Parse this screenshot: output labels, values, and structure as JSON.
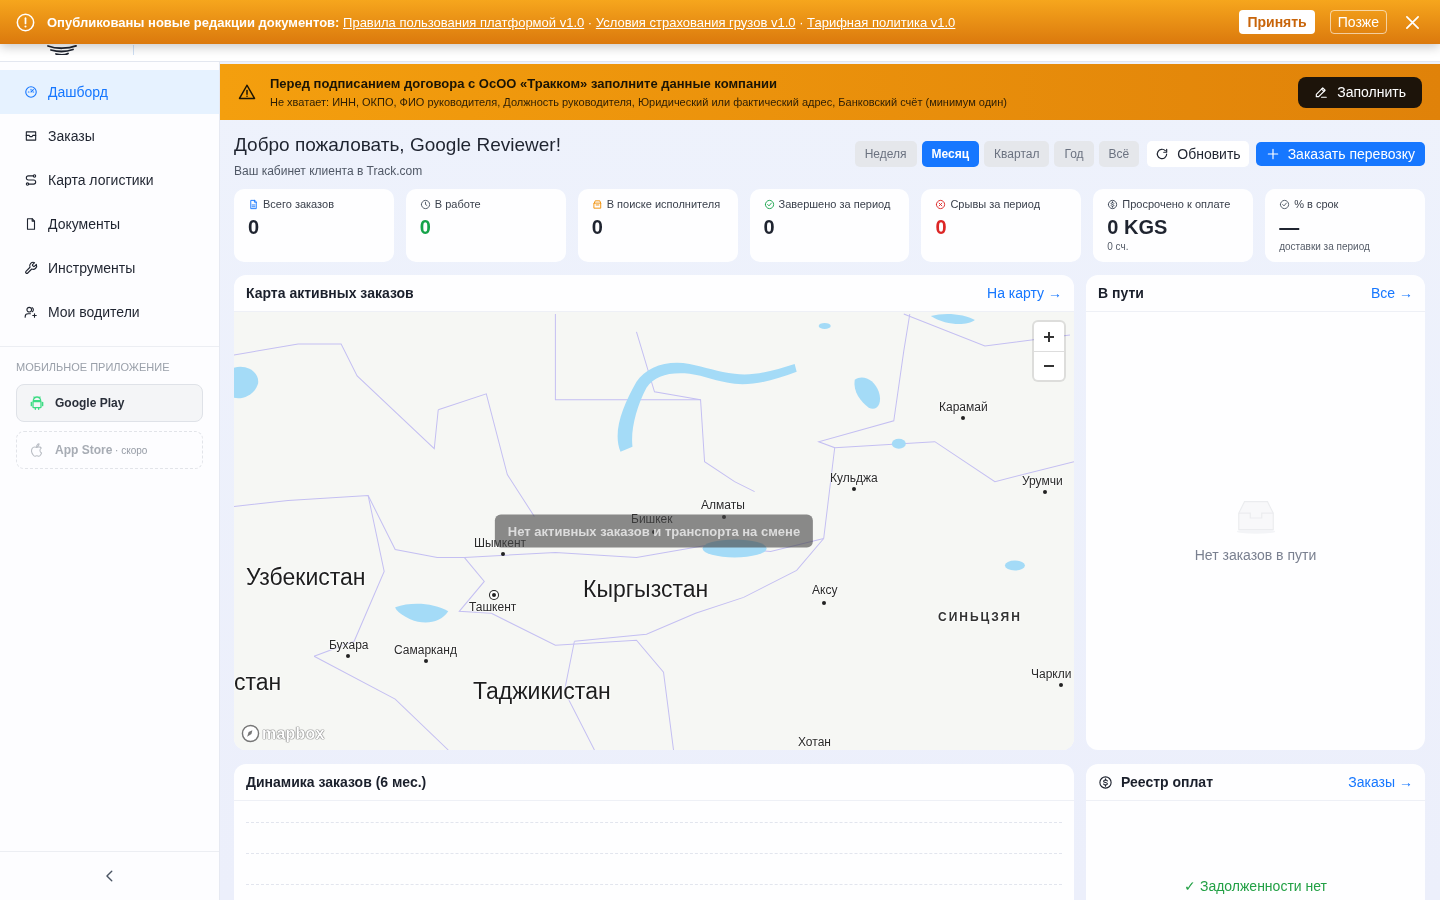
{
  "notice_banner": {
    "lead": "Опубликованы новые редакции документов:",
    "links": [
      "Правила пользования платформой v1.0",
      "Условия страхования грузов v1.0",
      "Тарифная политика v1.0"
    ],
    "separator": "·",
    "accept_button": "Принять",
    "later_button": "Позже"
  },
  "sidebar": {
    "items": [
      {
        "label": "Дашборд",
        "selected": true
      },
      {
        "label": "Заказы",
        "selected": false
      },
      {
        "label": "Карта логистики",
        "selected": false
      },
      {
        "label": "Документы",
        "selected": false
      },
      {
        "label": "Инструменты",
        "selected": false
      },
      {
        "label": "Мои водители",
        "selected": false
      }
    ],
    "mobile_app": {
      "heading": "МОБИЛЬНОЕ ПРИЛОЖЕНИЕ",
      "stores": [
        {
          "label": "Google Play",
          "disabled": false
        },
        {
          "label": "App Store",
          "note": "· скоро",
          "disabled": true
        }
      ]
    }
  },
  "company_alert": {
    "title": "Перед подписанием договора с ОсОО «Тракком» заполните данные компании",
    "missing": "Не хватает: ИНН, ОКПО, ФИО руководителя, Должность руководителя, Юридический или фактический адрес, Банковский счёт (минимум один)",
    "button": "Заполнить"
  },
  "welcome": {
    "title": "Добро пожаловать, Google Reviewer!",
    "subtitle": "Ваш кабинет клиента в Track.com"
  },
  "periods": [
    {
      "label": "Неделя",
      "selected": false
    },
    {
      "label": "Месяц",
      "selected": true
    },
    {
      "label": "Квартал",
      "selected": false
    },
    {
      "label": "Год",
      "selected": false
    },
    {
      "label": "Всё",
      "selected": false
    }
  ],
  "refresh_button": "Обновить",
  "order_button": "Заказать перевозку",
  "stats": [
    {
      "label": "Всего заказов",
      "value": "0",
      "color": "#1f2430"
    },
    {
      "label": "В работе",
      "value": "0",
      "color": "#16a34a"
    },
    {
      "label": "В поиске исполнителя",
      "value": "0",
      "color": "#1f2430"
    },
    {
      "label": "Завершено за период",
      "value": "0",
      "color": "#1f2430"
    },
    {
      "label": "Срывы за период",
      "value": "0",
      "color": "#dc2626"
    },
    {
      "label": "Просрочено к оплате",
      "value": "0 KGS",
      "note": "0 сч.",
      "color": "#1f2430"
    },
    {
      "label": "% в срок",
      "value": "—",
      "note": "доставки за период",
      "color": "#1f2430"
    }
  ],
  "map_card": {
    "title": "Карта активных заказов",
    "link": "На карту →",
    "labels": [
      {
        "text": "Карамай",
        "kind": "city"
      },
      {
        "text": "Кульджа",
        "kind": "city"
      },
      {
        "text": "Урумчи",
        "kind": "city"
      },
      {
        "text": "Алматы",
        "kind": "city"
      },
      {
        "text": "Бишкек",
        "kind": "city"
      },
      {
        "text": "Шымкент",
        "kind": "city"
      },
      {
        "text": "Узбекистан",
        "kind": "country"
      },
      {
        "text": "Ташкент",
        "kind": "capital"
      },
      {
        "text": "Кыргызстан",
        "kind": "country"
      },
      {
        "text": "Аксу",
        "kind": "city"
      },
      {
        "text": "СИНЬЦЗЯН",
        "kind": "region"
      },
      {
        "text": "Бухара",
        "kind": "city"
      },
      {
        "text": "Самарканд",
        "kind": "city"
      },
      {
        "text": "Чаркли",
        "kind": "city"
      },
      {
        "text": "стан",
        "kind": "country"
      },
      {
        "text": "Таджикистан",
        "kind": "country"
      },
      {
        "text": "Хотан",
        "kind": "place"
      }
    ],
    "empty_message": "Нет активных заказов и транспорта на смене",
    "attribution": "mapbox"
  },
  "in_transit": {
    "title": "В пути",
    "link": "Все →",
    "empty": "Нет заказов в пути"
  },
  "orders_chart": {
    "title": "Динамика заказов (6 мес.)"
  },
  "payments": {
    "title": "Реестр оплат",
    "link": "Заказы →",
    "status": "✓ Задолженности нет"
  }
}
